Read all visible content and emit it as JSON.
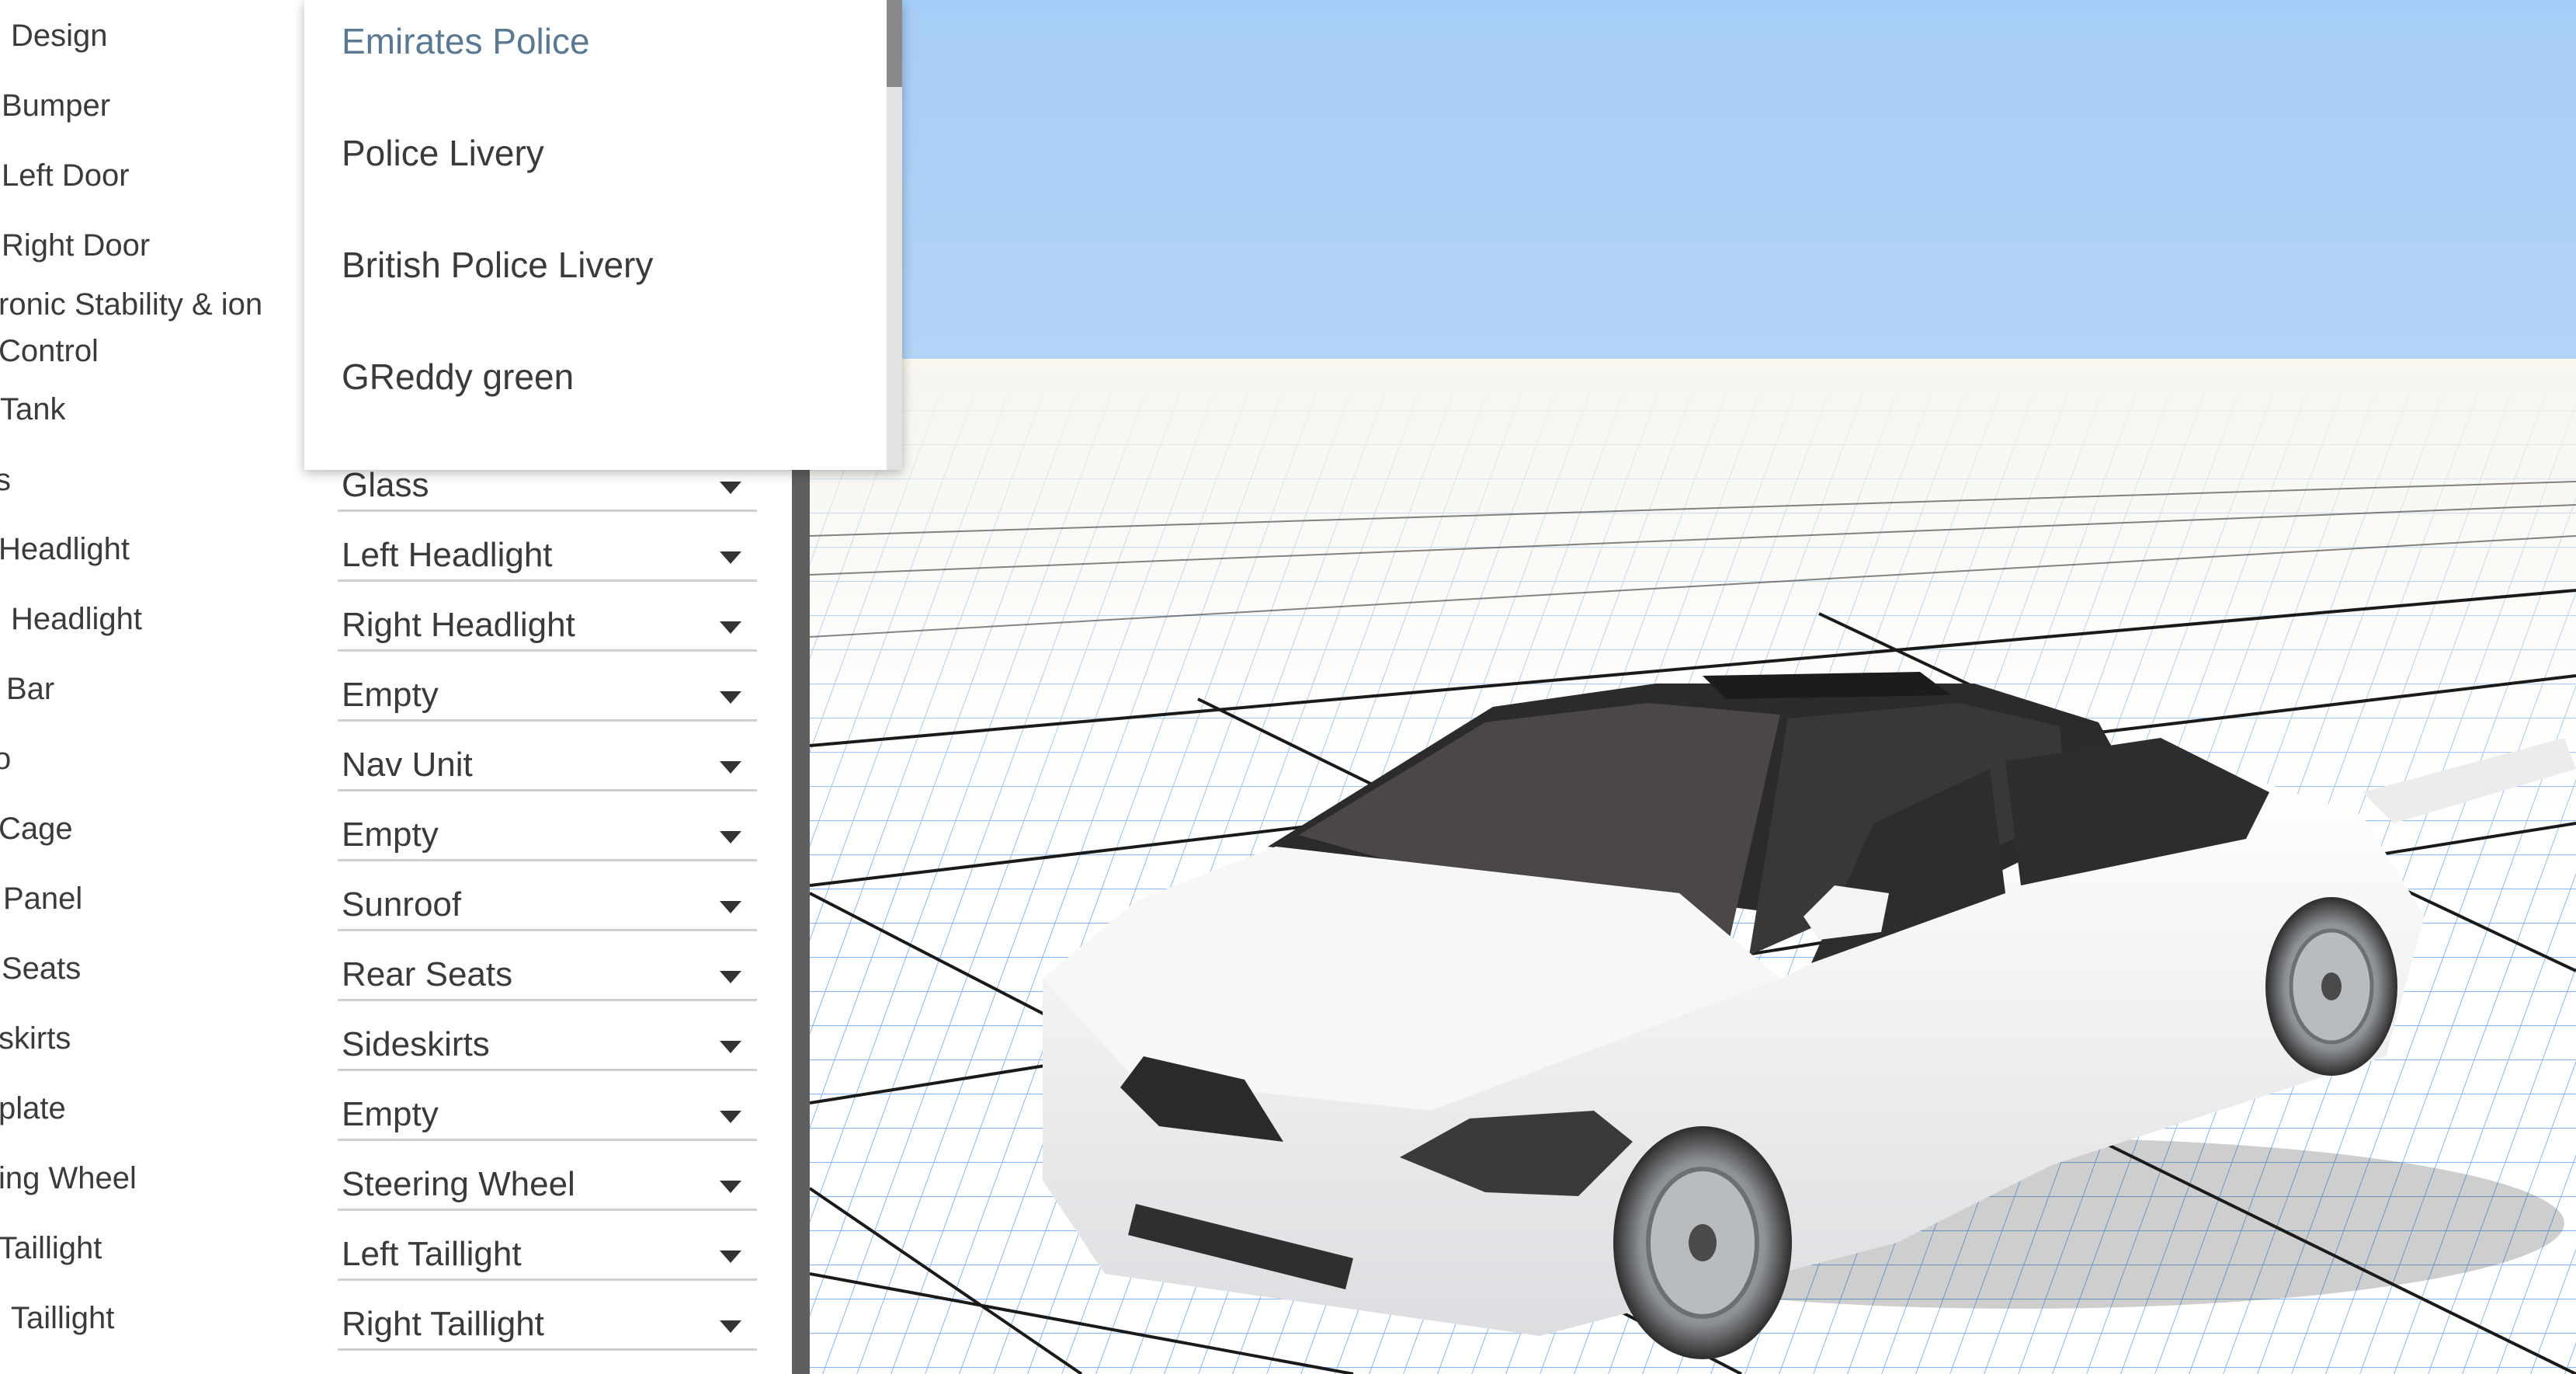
{
  "config_rows": [
    {
      "label": "Design",
      "value": ""
    },
    {
      "label": "Bumper",
      "value": ""
    },
    {
      "label": "Left Door",
      "value": ""
    },
    {
      "label": "Right Door",
      "value": ""
    },
    {
      "label": "ronic Stability & ion Control",
      "value": ""
    },
    {
      "label": "Tank",
      "value": ""
    },
    {
      "label": "s",
      "value": "Glass"
    },
    {
      "label": "Headlight",
      "value": "Left Headlight"
    },
    {
      "label": "Headlight",
      "value": "Right Headlight"
    },
    {
      "label": "Bar",
      "value": "Empty"
    },
    {
      "label": "o",
      "value": "Nav Unit"
    },
    {
      "label": "Cage",
      "value": "Empty"
    },
    {
      "label": "Panel",
      "value": "Sunroof"
    },
    {
      "label": "Seats",
      "value": "Rear Seats"
    },
    {
      "label": "skirts",
      "value": "Sideskirts"
    },
    {
      "label": "plate",
      "value": "Empty"
    },
    {
      "label": "ing Wheel",
      "value": "Steering Wheel"
    },
    {
      "label": "Taillight",
      "value": "Left Taillight"
    },
    {
      "label": "Taillight",
      "value": "Right Taillight"
    }
  ],
  "dropdown": {
    "options": [
      "Emirates Police",
      "Police Livery",
      "British Police Livery",
      "GReddy green"
    ],
    "highlighted": "Emirates Police"
  },
  "colors": {
    "sky_top": "#a6cdf7",
    "grid_line": "#3d85e0",
    "car_body": "#f2f2f2",
    "panel_divider": "#5f5f5f",
    "highlight_text": "#5a7891"
  }
}
